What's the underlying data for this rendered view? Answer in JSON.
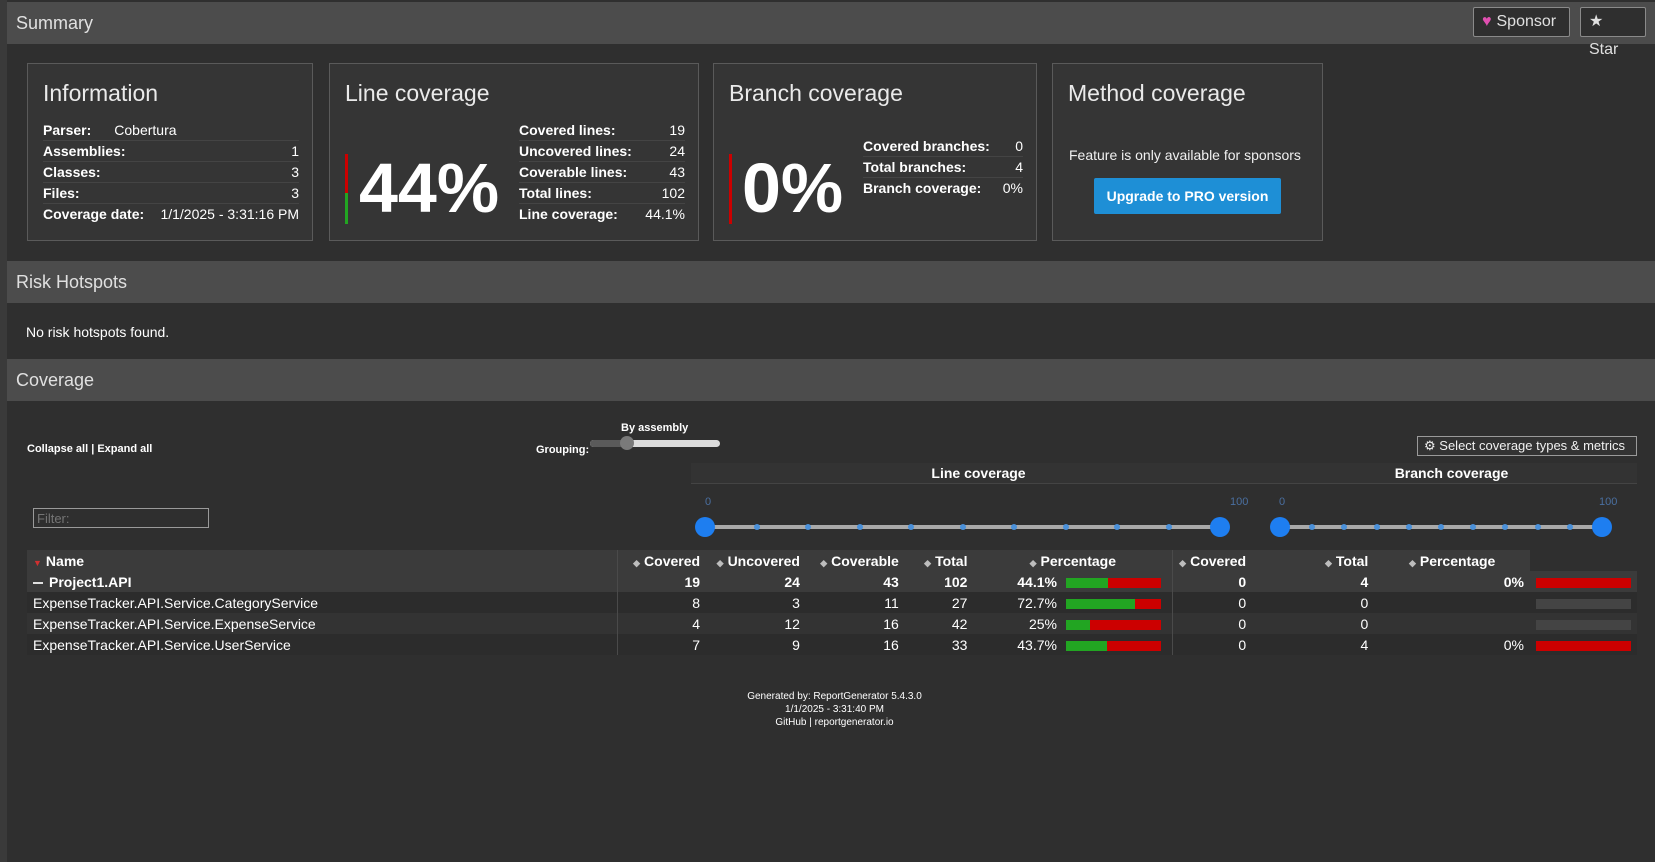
{
  "summary": {
    "title": "Summary",
    "sponsor_label": "Sponsor",
    "star_label": "Star",
    "information": {
      "title": "Information",
      "rows": [
        {
          "key": "Parser:",
          "value": "Cobertura"
        },
        {
          "key": "Assemblies:",
          "value": "1"
        },
        {
          "key": "Classes:",
          "value": "3"
        },
        {
          "key": "Files:",
          "value": "3"
        },
        {
          "key": "Coverage date:",
          "value": "1/1/2025 - 3:31:16 PM"
        }
      ]
    },
    "line_coverage": {
      "title": "Line coverage",
      "percent_text": "44%",
      "percent": 44.1,
      "rows": [
        {
          "key": "Covered lines:",
          "value": "19"
        },
        {
          "key": "Uncovered lines:",
          "value": "24"
        },
        {
          "key": "Coverable lines:",
          "value": "43"
        },
        {
          "key": "Total lines:",
          "value": "102"
        },
        {
          "key": "Line coverage:",
          "value": "44.1%"
        }
      ]
    },
    "branch_coverage": {
      "title": "Branch coverage",
      "percent_text": "0%",
      "percent": 0,
      "rows": [
        {
          "key": "Covered branches:",
          "value": "0"
        },
        {
          "key": "Total branches:",
          "value": "4"
        },
        {
          "key": "Branch coverage:",
          "value": "0%"
        }
      ]
    },
    "method_coverage": {
      "title": "Method coverage",
      "note": "Feature is only available for sponsors",
      "button": "Upgrade to PRO version"
    }
  },
  "risk": {
    "title": "Risk Hotspots",
    "message": "No risk hotspots found."
  },
  "coverage": {
    "title": "Coverage",
    "collapse_all": "Collapse all",
    "expand_all": "Expand all",
    "grouping_label": "Grouping:",
    "grouping_value": "By assembly",
    "metrics_button": "Select coverage types & metrics",
    "filter_placeholder": "Filter:",
    "group_headers": {
      "line": "Line coverage",
      "branch": "Branch coverage"
    },
    "range": {
      "min": "0",
      "max": "100"
    },
    "columns": [
      "Name",
      "Covered",
      "Uncovered",
      "Coverable",
      "Total",
      "Percentage",
      "Covered",
      "Total",
      "Percentage"
    ],
    "assembly": {
      "name": "Project1.API",
      "line_covered": "19",
      "line_uncovered": "24",
      "line_coverable": "43",
      "line_total": "102",
      "line_pct": "44.1%",
      "line_pct_value": 44.1,
      "branch_covered": "0",
      "branch_total": "4",
      "branch_pct": "0%",
      "branch_pct_value": 0
    },
    "classes": [
      {
        "name": "ExpenseTracker.API.Service.CategoryService",
        "line_covered": "8",
        "line_uncovered": "3",
        "line_coverable": "11",
        "line_total": "27",
        "line_pct": "72.7%",
        "line_pct_value": 72.7,
        "branch_covered": "0",
        "branch_total": "0",
        "branch_pct": "",
        "branch_pct_value": null
      },
      {
        "name": "ExpenseTracker.API.Service.ExpenseService",
        "line_covered": "4",
        "line_uncovered": "12",
        "line_coverable": "16",
        "line_total": "42",
        "line_pct": "25%",
        "line_pct_value": 25,
        "branch_covered": "0",
        "branch_total": "0",
        "branch_pct": "",
        "branch_pct_value": null
      },
      {
        "name": "ExpenseTracker.API.Service.UserService",
        "line_covered": "7",
        "line_uncovered": "9",
        "line_coverable": "16",
        "line_total": "33",
        "line_pct": "43.7%",
        "line_pct_value": 43.7,
        "branch_covered": "0",
        "branch_total": "4",
        "branch_pct": "0%",
        "branch_pct_value": 0
      }
    ]
  },
  "footer": {
    "generated_by": "Generated by: ReportGenerator 5.4.3.0",
    "date": "1/1/2025 - 3:31:40 PM",
    "github": "GitHub",
    "site": "reportgenerator.io"
  },
  "colors": {
    "covered": "#22a522",
    "uncovered": "#cc0000",
    "accent": "#1e8fd6",
    "knob": "#1e7ef0"
  }
}
